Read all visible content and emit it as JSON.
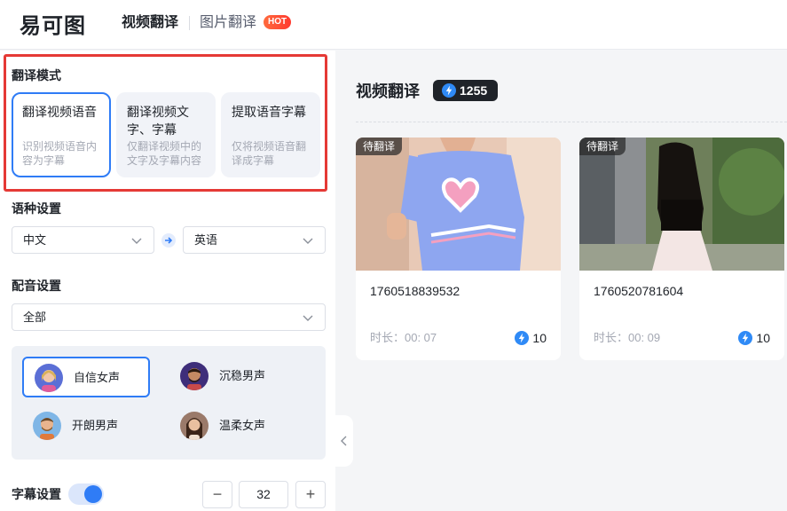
{
  "app": {
    "logo_text": "易可图"
  },
  "nav": {
    "video_translate": "视频翻译",
    "image_translate": "图片翻译",
    "hot_badge": "HOT"
  },
  "mode_section": {
    "title": "翻译模式",
    "modes": [
      {
        "title": "翻译视频语音",
        "desc": "识别视频语音内容为字幕",
        "selected": true
      },
      {
        "title": "翻译视频文字、字幕",
        "desc": "仅翻译视频中的文字及字幕内容",
        "selected": false
      },
      {
        "title": "提取语音字幕",
        "desc": "仅将视频语音翻译成字幕",
        "selected": false
      }
    ]
  },
  "language_section": {
    "title": "语种设置",
    "source": "中文",
    "target": "英语"
  },
  "dubbing_section": {
    "title": "配音设置",
    "filter": "全部",
    "voices": [
      {
        "label": "自信女声",
        "selected": true
      },
      {
        "label": "沉稳男声",
        "selected": false
      },
      {
        "label": "开朗男声",
        "selected": false
      },
      {
        "label": "温柔女声",
        "selected": false
      }
    ]
  },
  "subtitle_section": {
    "title": "字幕设置",
    "enabled": true,
    "minus": "−",
    "value": "32",
    "plus": "+"
  },
  "main": {
    "title": "视频翻译",
    "credits": "1255",
    "videos": [
      {
        "status": "待翻译",
        "name": "1760518839532",
        "duration": "时长：00: 07",
        "cost": "10"
      },
      {
        "status": "待翻译",
        "name": "1760520781604",
        "duration": "时长：00: 09",
        "cost": "10"
      }
    ]
  },
  "colors": {
    "accent": "#2f7cf6",
    "highlight_border": "#e53935",
    "dark_badge": "#1f2329"
  }
}
